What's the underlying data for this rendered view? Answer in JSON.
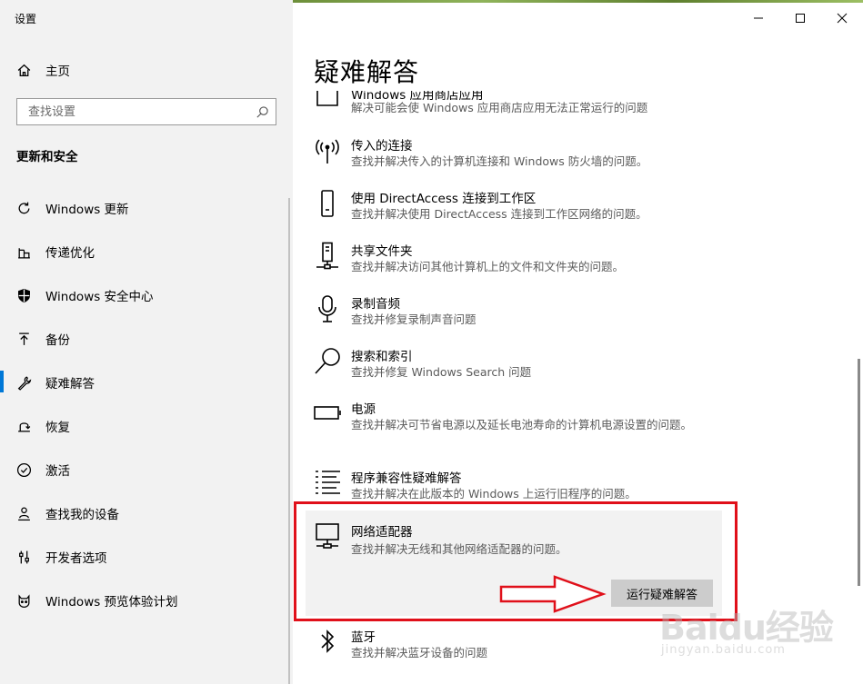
{
  "window": {
    "title": "设置",
    "controls": [
      "minimize-icon",
      "maximize-icon",
      "close-icon"
    ]
  },
  "sidebar": {
    "home_label": "主页",
    "search_placeholder": "查找设置",
    "section_heading": "更新和安全",
    "items": [
      {
        "label": "Windows 更新",
        "icon": "refresh-icon"
      },
      {
        "label": "传递优化",
        "icon": "delivery-optimization-icon"
      },
      {
        "label": "Windows 安全中心",
        "icon": "shield-icon"
      },
      {
        "label": "备份",
        "icon": "backup-arrow-icon"
      },
      {
        "label": "疑难解答",
        "icon": "wrench-icon",
        "active": true
      },
      {
        "label": "恢复",
        "icon": "recovery-icon"
      },
      {
        "label": "激活",
        "icon": "check-circle-icon"
      },
      {
        "label": "查找我的设备",
        "icon": "person-location-icon"
      },
      {
        "label": "开发者选项",
        "icon": "developer-sliders-icon"
      },
      {
        "label": "Windows 预览体验计划",
        "icon": "insider-cat-icon"
      }
    ]
  },
  "main": {
    "page_title": "疑难解答",
    "items": [
      {
        "title": "Windows 应用商店应用",
        "desc": "解决可能会使 Windows 应用商店应用无法正常运行的问题",
        "icon": "store-app-icon"
      },
      {
        "title": "传入的连接",
        "desc": "查找并解决传入的计算机连接和 Windows 防火墙的问题。",
        "icon": "antenna-icon"
      },
      {
        "title": "使用 DirectAccess 连接到工作区",
        "desc": "查找并解决使用 DirectAccess 连接到工作区网络的问题。",
        "icon": "phone-icon"
      },
      {
        "title": "共享文件夹",
        "desc": "查找并解决访问其他计算机上的文件和文件夹的问题。",
        "icon": "network-share-icon"
      },
      {
        "title": "录制音频",
        "desc": "查找并修复录制声音问题",
        "icon": "microphone-icon"
      },
      {
        "title": "搜索和索引",
        "desc": "查找并修复 Windows Search 问题",
        "icon": "search-icon"
      },
      {
        "title": "电源",
        "desc": "查找并解决可节省电源以及延长电池寿命的计算机电源设置的问题。",
        "icon": "battery-icon"
      },
      {
        "title": "程序兼容性疑难解答",
        "desc": "查找并解决在此版本的 Windows 上运行旧程序的问题。",
        "icon": "list-icon"
      },
      {
        "title": "蓝牙",
        "desc": "查找并解决蓝牙设备的问题",
        "icon": "bluetooth-icon"
      }
    ],
    "selected": {
      "title": "网络适配器",
      "desc": "查找并解决无线和其他网络适配器的问题。",
      "icon": "network-adapter-icon",
      "run_button": "运行疑难解答"
    }
  },
  "watermark": {
    "logo": "Baidu经验",
    "url": "jingyan.baidu.com"
  },
  "colors": {
    "accent": "#0078d7",
    "highlight": "#e0101a",
    "sidebar_bg": "#f2f2f2",
    "card_bg": "#f2f2f2"
  }
}
